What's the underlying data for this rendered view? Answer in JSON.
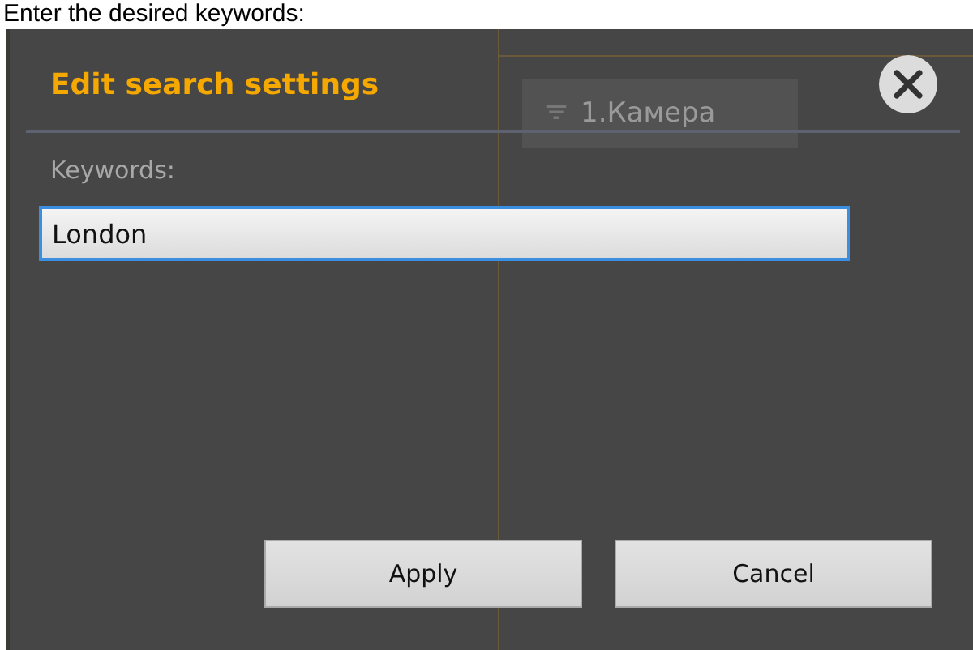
{
  "caption": "Enter the desired keywords:",
  "background": {
    "camera_tab": "1.Камера"
  },
  "dialog": {
    "title": "Edit search settings",
    "field_label": "Keywords:",
    "field_value": "London",
    "buttons": [
      "Apply",
      "Cancel"
    ]
  }
}
